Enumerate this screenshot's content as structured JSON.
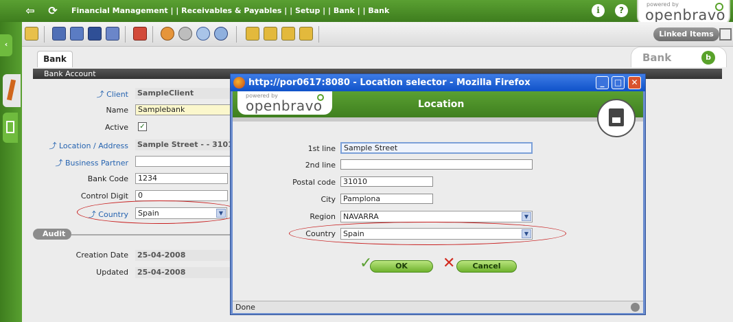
{
  "topbar": {
    "breadcrumb": "Financial Management | | Receivables & Payables | | Setup | | Bank  | |  Bank",
    "logo_powered": "powered by",
    "logo_brand": "openbravo"
  },
  "toolbar": {
    "linked_items": "Linked Items"
  },
  "tabs": {
    "active": "Bank",
    "window_badge": "Bank"
  },
  "form": {
    "section": "Bank Account",
    "fields": {
      "client": {
        "label": "Client",
        "value": "SampleClient"
      },
      "name": {
        "label": "Name",
        "value": "Samplebank"
      },
      "active": {
        "label": "Active",
        "checked": true
      },
      "location": {
        "label": "Location / Address",
        "value": "Sample Street -  - 3101"
      },
      "business_partner": {
        "label": "Business Partner",
        "value": ""
      },
      "bank_code": {
        "label": "Bank Code",
        "value": "1234"
      },
      "control_digit": {
        "label": "Control Digit",
        "value": "0"
      },
      "country": {
        "label": "Country",
        "value": "Spain"
      }
    },
    "audit": {
      "title": "Audit",
      "creation_date": {
        "label": "Creation Date",
        "value": "25-04-2008"
      },
      "updated": {
        "label": "Updated",
        "value": "25-04-2008"
      }
    }
  },
  "popup": {
    "window_title": "http://por0617:8080 - Location selector - Mozilla Firefox",
    "logo_powered": "powered by",
    "logo_brand": "openbravo",
    "heading": "Location",
    "fields": {
      "line1": {
        "label": "1st line",
        "value": "Sample Street"
      },
      "line2": {
        "label": "2nd line",
        "value": ""
      },
      "postal": {
        "label": "Postal code",
        "value": "31010"
      },
      "city": {
        "label": "City",
        "value": "Pamplona"
      },
      "region": {
        "label": "Region",
        "value": "NAVARRA"
      },
      "country": {
        "label": "Country",
        "value": "Spain"
      }
    },
    "ok_label": "OK",
    "cancel_label": "Cancel",
    "status": "Done"
  },
  "colors": {
    "brand_green": "#4a8f24",
    "link_blue": "#2563b0",
    "highlight_red": "#c81e1e",
    "title_blue": "#0f52c9"
  }
}
